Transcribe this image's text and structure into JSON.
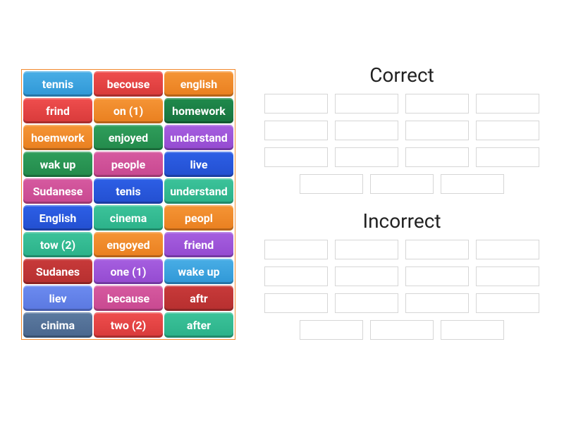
{
  "tiles": [
    [
      {
        "label": "tennis",
        "color": "c-blue"
      },
      {
        "label": "becouse",
        "color": "c-red"
      },
      {
        "label": "english",
        "color": "c-orange"
      }
    ],
    [
      {
        "label": "frind",
        "color": "c-red"
      },
      {
        "label": "on (1)",
        "color": "c-orange"
      },
      {
        "label": "homework",
        "color": "c-dgreen"
      }
    ],
    [
      {
        "label": "hoemwork",
        "color": "c-orange"
      },
      {
        "label": "enjoyed",
        "color": "c-green"
      },
      {
        "label": "undarstand",
        "color": "c-purple"
      }
    ],
    [
      {
        "label": "wak up",
        "color": "c-green"
      },
      {
        "label": "people",
        "color": "c-pink"
      },
      {
        "label": "live",
        "color": "c-dblue"
      }
    ],
    [
      {
        "label": "Sudanese",
        "color": "c-pink"
      },
      {
        "label": "tenis",
        "color": "c-dblue"
      },
      {
        "label": "understand",
        "color": "c-teal"
      }
    ],
    [
      {
        "label": "English",
        "color": "c-dblue"
      },
      {
        "label": "cinema",
        "color": "c-teal"
      },
      {
        "label": "peopl",
        "color": "c-orange"
      }
    ],
    [
      {
        "label": "tow (2)",
        "color": "c-teal"
      },
      {
        "label": "engoyed",
        "color": "c-orange"
      },
      {
        "label": "friend",
        "color": "c-purple"
      }
    ],
    [
      {
        "label": "Sudanes",
        "color": "c-dred"
      },
      {
        "label": "one (1)",
        "color": "c-purple"
      },
      {
        "label": "wake up",
        "color": "c-blue"
      }
    ],
    [
      {
        "label": "liev",
        "color": "c-lblue"
      },
      {
        "label": "because",
        "color": "c-pink"
      },
      {
        "label": "aftr",
        "color": "c-dred"
      }
    ],
    [
      {
        "label": "cinima",
        "color": "c-steel"
      },
      {
        "label": "two (2)",
        "color": "c-red"
      },
      {
        "label": "after",
        "color": "c-teal"
      }
    ]
  ],
  "groups": [
    {
      "title": "Correct",
      "slots": 15
    },
    {
      "title": "Incorrect",
      "slots": 15
    }
  ]
}
